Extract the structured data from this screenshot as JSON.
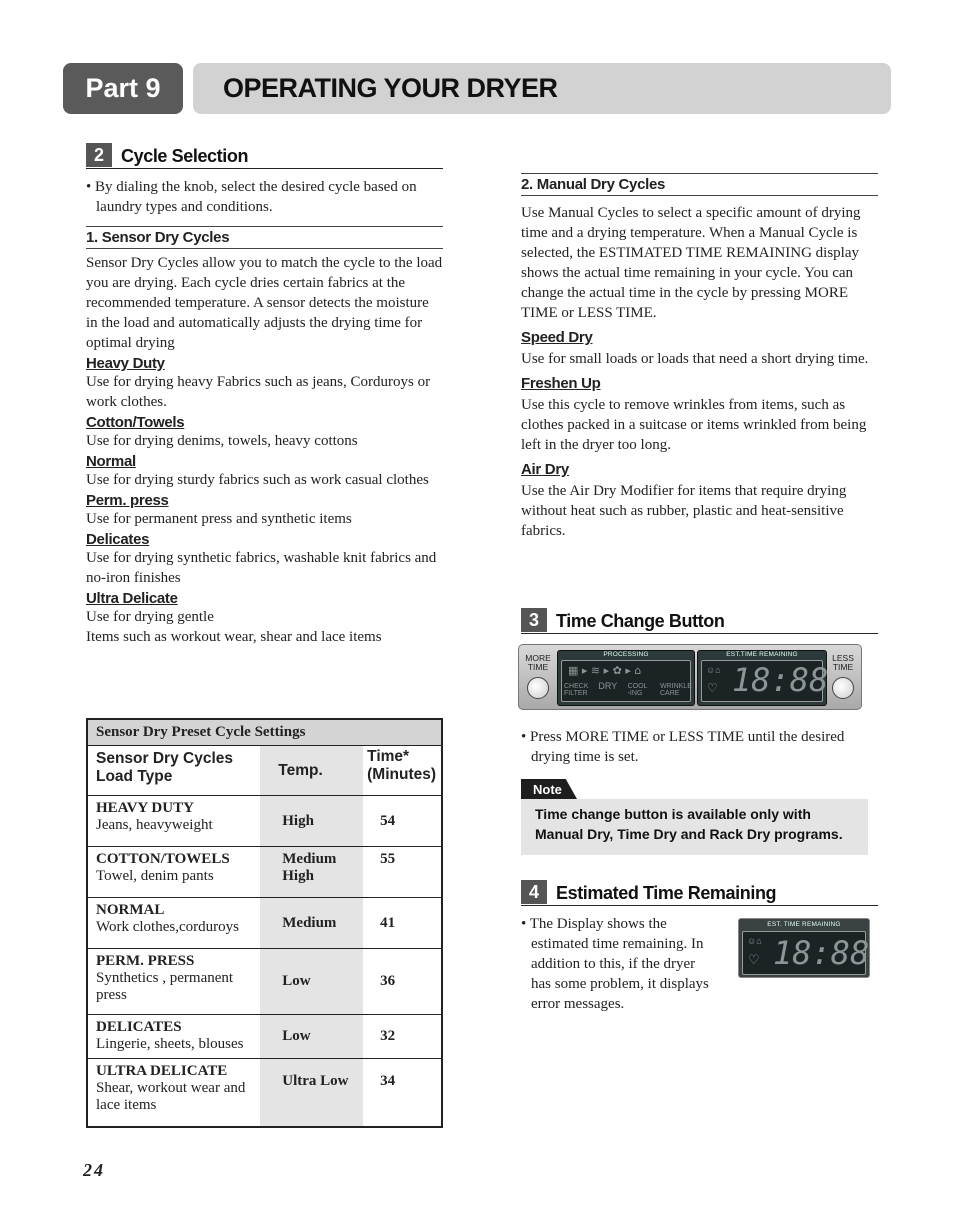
{
  "header": {
    "part": "Part 9",
    "title": "OPERATING YOUR DRYER"
  },
  "cycle_selection": {
    "num": "2",
    "title": "Cycle Selection",
    "intro_bullet": "• By dialing the knob, select the desired cycle based on laundry types and conditions.",
    "sensor": {
      "heading": "1. Sensor Dry Cycles",
      "text": "Sensor Dry Cycles allow you to match the cycle to the load you are drying. Each cycle dries certain fabrics at the recommended temperature. A sensor detects the moisture in the load and automatically adjusts the drying time for optimal drying",
      "items": [
        {
          "name": "Heavy Duty",
          "desc": "Use for drying heavy Fabrics such as jeans, Corduroys or work clothes."
        },
        {
          "name": "Cotton/Towels",
          "desc": "Use for drying denims, towels, heavy cottons"
        },
        {
          "name": "Normal",
          "desc": "Use for drying sturdy fabrics such as work casual clothes"
        },
        {
          "name": "Perm. press",
          "desc": "Use for permanent press and synthetic items"
        },
        {
          "name": "Delicates",
          "desc": "Use for drying synthetic fabrics, washable knit fabrics and no-iron finishes"
        },
        {
          "name": "Ultra Delicate",
          "desc": "Use for drying gentle",
          "desc2": "Items such as workout wear, shear and lace items"
        }
      ]
    }
  },
  "table": {
    "caption": "Sensor Dry Preset Cycle Settings",
    "headers": {
      "load": "Sensor Dry Cycles Load Type",
      "temp": "Temp.",
      "time": "Time* (Minutes)"
    },
    "rows": [
      {
        "name": "HEAVY DUTY",
        "load": "Jeans, heavyweight",
        "temp": "High",
        "time": "54"
      },
      {
        "name": "COTTON/TOWELS",
        "load": "Towel, denim pants",
        "temp": "Medium High",
        "time": "55"
      },
      {
        "name": "NORMAL",
        "load": "Work clothes,corduroys",
        "temp": "Medium",
        "time": "41"
      },
      {
        "name": "PERM. PRESS",
        "load": "Synthetics , permanent press",
        "temp": "Low",
        "time": "36"
      },
      {
        "name": "DELICATES",
        "load": "Lingerie, sheets, blouses",
        "temp": "Low",
        "time": "32"
      },
      {
        "name": "ULTRA DELICATE",
        "load": "Shear, workout wear and lace items",
        "temp": "Ultra Low",
        "time": "34"
      }
    ]
  },
  "manual": {
    "heading": "2. Manual Dry Cycles",
    "text": "Use Manual Cycles to select a specific amount of drying time and a drying temperature. When a Manual Cycle is selected, the ESTIMATED TIME REMAINING display shows the actual time remaining in your cycle. You can change the actual time in the cycle by pressing MORE TIME or LESS TIME.",
    "items": [
      {
        "name": "Speed Dry",
        "desc": "Use for small loads or loads that need a short drying time."
      },
      {
        "name": "Freshen Up",
        "desc": "Use this cycle to remove wrinkles from items, such as clothes packed in a suitcase or items wrinkled from being left in the dryer too long."
      },
      {
        "name": "Air Dry",
        "desc": "Use the Air Dry Modifier for items that require drying without heat such as rubber, plastic and heat-sensitive fabrics."
      }
    ]
  },
  "time_change": {
    "num": "3",
    "title": "Time Change Button",
    "panel": {
      "more": "MORE TIME",
      "less": "LESS TIME",
      "processing": "PROCESSING",
      "est": "EST.TIME REMAINING",
      "steps": [
        "CHECK FILTER",
        "DRY",
        "COOL -ING",
        "WRINKLE CARE"
      ],
      "digits": "18:88"
    },
    "bullet": "• Press MORE TIME or LESS TIME until the desired drying time is set."
  },
  "note": {
    "tag": "Note",
    "text": "Time change button is available only with Manual Dry, Time Dry and Rack Dry programs."
  },
  "est_time": {
    "num": "4",
    "title": "Estimated Time Remaining",
    "bullet": "• The Display shows the estimated time remaining. In addition to this, if the dryer has some problem, it displays error messages.",
    "display_title": "EST. TIME REMAINING",
    "digits": "18:88"
  },
  "page_number": "24"
}
